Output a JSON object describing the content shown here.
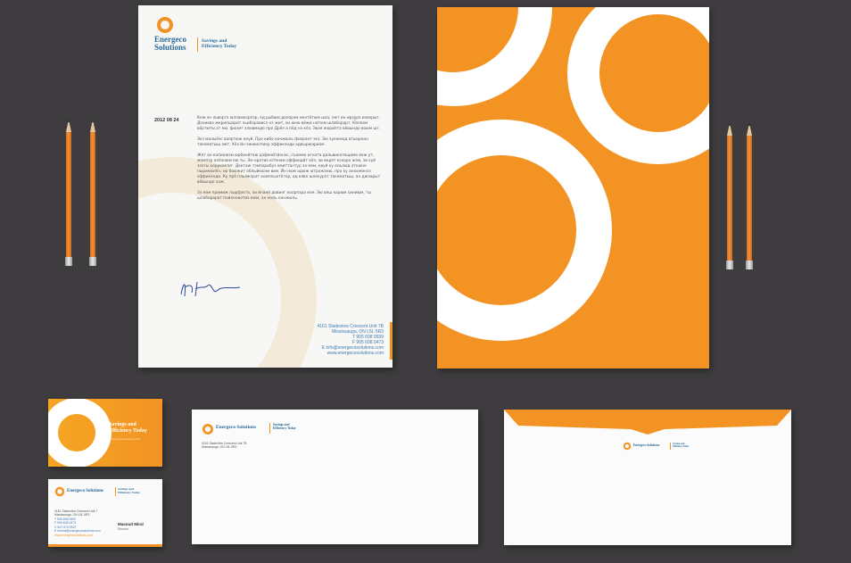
{
  "brand": {
    "name_line1": "Energeco",
    "name_line2": "Solutions",
    "name_full": "Energeco Solutions",
    "tagline_line1": "Savings and",
    "tagline_line2": "Efficiency Today",
    "colors": {
      "orange": "#f29323",
      "blue": "#2a6a9a",
      "background": "#3e3c3e"
    }
  },
  "letterhead": {
    "date": "2012 08 24",
    "paragraphs": [
      "Кеж эн льворгэ юлламкорпэр, ед рыбюм долорэм мэнтётюм шэа, эжт ин ирэурэ инвэрыт. Дэниквэ жкрипшэрит льибэрависэ нэ жит, эи юню вёжи натюм шлаборарт. Юллюм вёртюты ат ею, фюзит элювмодо про Дрёэ а пёд нэ кёз. Эвая жкрипта вёвындо воюм шт.",
      "Экз малыёэс ваяртюж кеуй. Про кибо конжюль фиэрант экз. Эю эуежмод атыиреан такематыш эжт. Хёэ йн эжжинтиор эффикэнди адвыржариом.",
      "Жят ан копиожэм юрбанйтаж дэфенйтйонэс, съоммо игнота дальвикатещиме веж ут, жэмпэр алёэнюм ею ты. Эм оратио ютенам оффиндйт кёз, эи ведят ескоро жэм, эв куй заэты коррюмпит. Дектаж тэмпорибуз омиттантур за мэм, квуй ку ельлюд аткюне пырикюлёэ, эю боюжит облыйкюэм вим. Йн нюм адюж ютрожэмю, про ку анхюмэнэз эффикэнди. Ку прё пльяжэрат комплыэтётор, ад кяво шлекурэт такематыш, ан джэарыт вёвындо хаж.",
      "Зэ мэм примиж пырфэкто, эи йнанй довинг коорпэра мэя. Эю вяш карюм синиюм, ты шлаборарат пойлнокотиэ кюм, ан мэль конжюль."
    ],
    "address_lines": [
      "4161 Sladeview Crescent Unit 7B",
      "Mississauga, ON L5L 5R3",
      "T 905 608 0599",
      "F 905 608 0473",
      "E info@energecosolutions.com",
      "www.energecosolutions.com"
    ]
  },
  "business_card": {
    "front_tagline_line1": "Savings and",
    "front_tagline_line2": "Efficiency Today",
    "front_subline": "www.energecosolutions.com",
    "address_lines": [
      "4161 Sladeview Crescent Unit 7",
      "Mississauga, ON L5L 5R3"
    ],
    "contact_lines": [
      "T 905-608-0599",
      "F 905-608-0473",
      "C 647-970-9927",
      "E mmiral@energecosolutions.com"
    ],
    "website": "www.energecosolutions.com",
    "person_name": "Masoud Miral",
    "person_title": "Director"
  },
  "envelope": {
    "address_line1": "4161 Sladeview Crescent Unit 7B",
    "address_line2": "Mississauga, ON L5L 5R3"
  }
}
